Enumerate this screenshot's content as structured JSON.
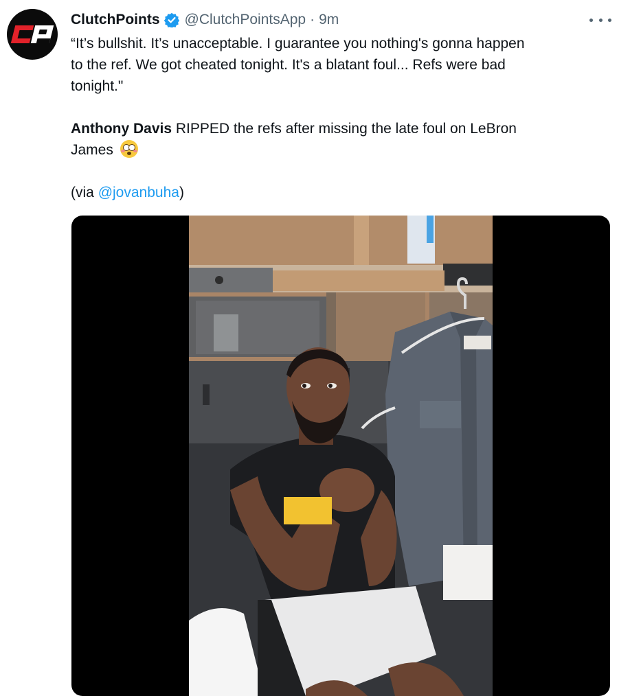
{
  "tweet": {
    "author": {
      "display_name": "ClutchPoints",
      "handle": "@ClutchPointsApp",
      "verified": true,
      "avatar_logo": "CP"
    },
    "separator": "·",
    "timestamp": "9m",
    "text": {
      "quote_line_1": "“It’s bullshit. It’s unacceptable. I guarantee you nothing's gonna happen",
      "quote_line_2": "to the ref. We got cheated tonight. It's a blatant foul... Refs were bad",
      "quote_line_3": "tonight.\"",
      "name_bold": "Anthony Davis",
      "sentence_line_1": " RIPPED the refs after missing the late foul on LeBron",
      "sentence_line_2": "James ",
      "emoji": "flushed-face-emoji",
      "via_prefix": "(via ",
      "via_mention": "@jovanbuha",
      "via_suffix": ")"
    },
    "media": {
      "type": "video",
      "description_icon": "video-thumbnail"
    }
  },
  "colors": {
    "text_primary": "#0f1419",
    "text_secondary": "#536471",
    "link": "#1d9bf0",
    "verified_badge": "#1d9bf0",
    "brand_red": "#e2222a"
  }
}
